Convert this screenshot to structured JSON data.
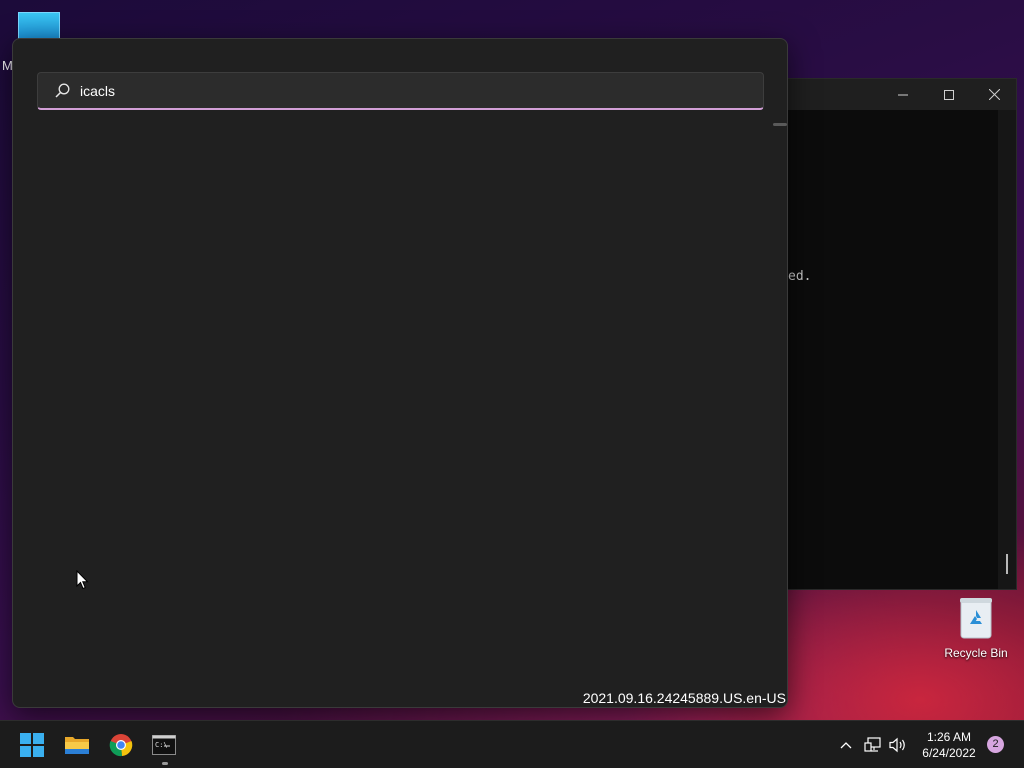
{
  "desktop": {
    "top_icon_label_fragment": "M",
    "recycle_bin_label": "Recycle Bin"
  },
  "console": {
    "visible_text": "ed."
  },
  "search": {
    "query": "icacls",
    "build_text": "2021.09.16.24245889.US.en-US"
  },
  "taskbar": {
    "apps": [
      {
        "name": "Start",
        "icon": "windows-logo-icon"
      },
      {
        "name": "File Explorer",
        "icon": "folder-icon"
      },
      {
        "name": "Google Chrome",
        "icon": "chrome-icon"
      },
      {
        "name": "Command Prompt",
        "icon": "terminal-icon",
        "running": true
      }
    ],
    "clock_time": "1:26 AM",
    "clock_date": "6/24/2022",
    "notification_count": "2"
  },
  "colors": {
    "accent": "#d29fd6",
    "flyout_bg": "#202020",
    "taskbar_bg": "#1c1c1c"
  }
}
